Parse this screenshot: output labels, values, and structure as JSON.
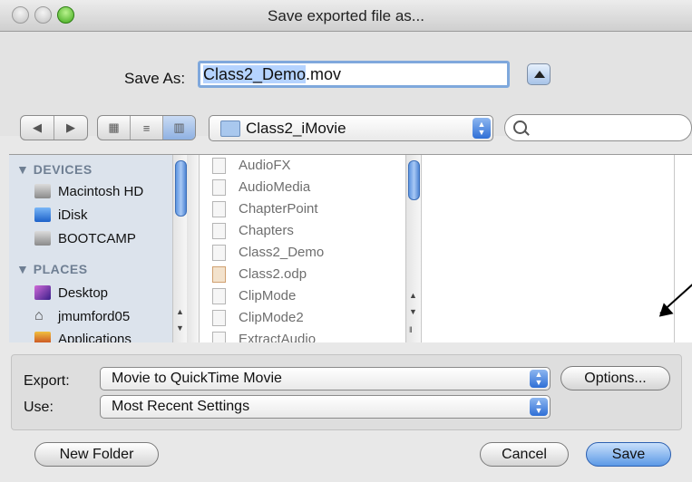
{
  "window": {
    "title": "Save exported file as..."
  },
  "save_as": {
    "label": "Save As:",
    "filename_selected": "Class2_Demo",
    "filename_ext": ".mov"
  },
  "toolbar": {
    "location_popup": "Class2_iMovie",
    "search_placeholder": ""
  },
  "sidebar": {
    "devices_header": "▼ DEVICES",
    "devices": [
      "Macintosh HD",
      "iDisk",
      "BOOTCAMP"
    ],
    "places_header": "▼ PLACES",
    "places": [
      "Desktop",
      "jmumford05",
      "Applications"
    ]
  },
  "files": [
    "AudioFX",
    "AudioMedia",
    "ChapterPoint",
    "Chapters",
    "Class2_Demo",
    "Class2.odp",
    "ClipMode",
    "ClipMode2",
    "ExtractAudio"
  ],
  "export": {
    "export_label": "Export:",
    "export_value": "Movie to QuickTime Movie",
    "options_button": "Options...",
    "use_label": "Use:",
    "use_value": "Most Recent Settings"
  },
  "buttons": {
    "new_folder": "New Folder",
    "cancel": "Cancel",
    "save": "Save"
  }
}
